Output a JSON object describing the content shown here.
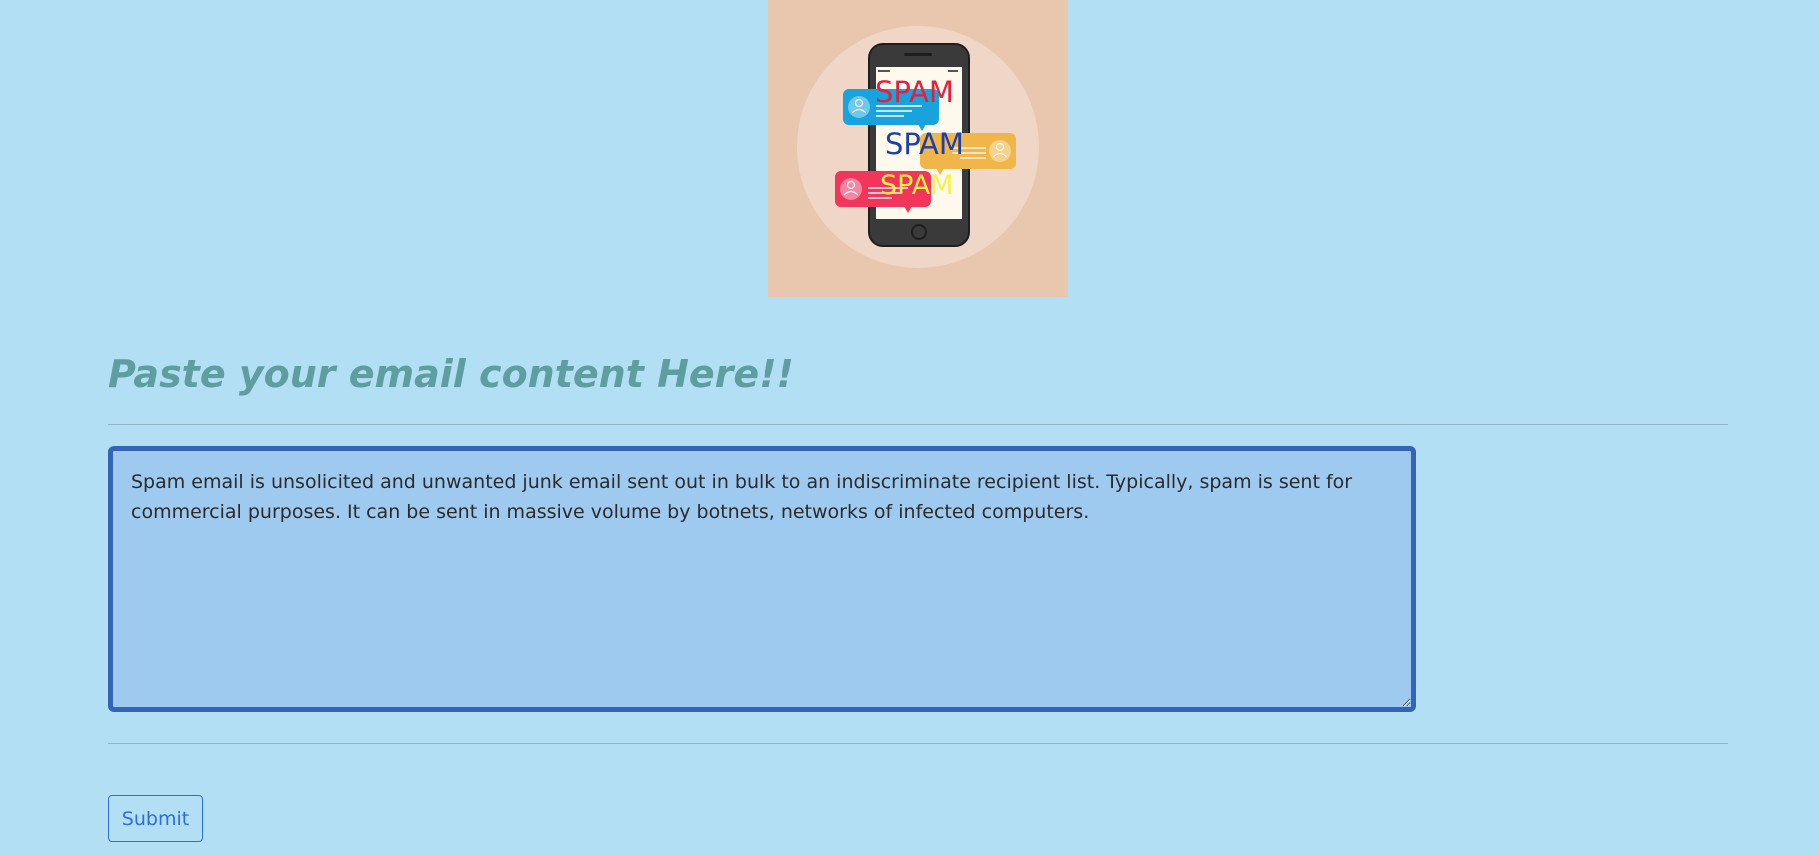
{
  "hero": {
    "spam_word_1": "SPAM",
    "spam_word_2": "SPAM",
    "spam_word_3": "SPAM"
  },
  "form": {
    "heading": "Paste your email content Here!!",
    "email_content": "Spam email is unsolicited and unwanted junk email sent out in bulk to an indiscriminate recipient list. Typically, spam is sent for commercial purposes. It can be sent in massive volume by botnets, networks of infected computers.",
    "submit_label": "Submit"
  },
  "colors": {
    "page_background": "#b2dff4",
    "heading": "#5f9ea0",
    "textarea_background": "#9ecaf0",
    "textarea_border": "#3463b8",
    "button_accent": "#2c6fdb",
    "spam_red": "#e0213f",
    "spam_blue": "#1f3fa8",
    "spam_yellow": "#f6f04a"
  }
}
